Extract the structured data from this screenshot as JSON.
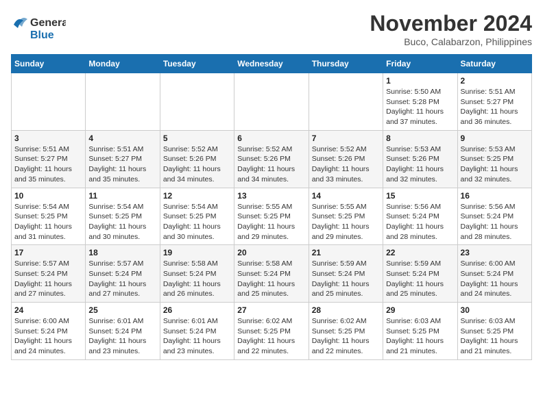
{
  "header": {
    "logo_general": "General",
    "logo_blue": "Blue",
    "month_title": "November 2024",
    "location": "Buco, Calabarzon, Philippines"
  },
  "weekdays": [
    "Sunday",
    "Monday",
    "Tuesday",
    "Wednesday",
    "Thursday",
    "Friday",
    "Saturday"
  ],
  "weeks": [
    [
      {
        "day": "",
        "info": ""
      },
      {
        "day": "",
        "info": ""
      },
      {
        "day": "",
        "info": ""
      },
      {
        "day": "",
        "info": ""
      },
      {
        "day": "",
        "info": ""
      },
      {
        "day": "1",
        "info": "Sunrise: 5:50 AM\nSunset: 5:28 PM\nDaylight: 11 hours\nand 37 minutes."
      },
      {
        "day": "2",
        "info": "Sunrise: 5:51 AM\nSunset: 5:27 PM\nDaylight: 11 hours\nand 36 minutes."
      }
    ],
    [
      {
        "day": "3",
        "info": "Sunrise: 5:51 AM\nSunset: 5:27 PM\nDaylight: 11 hours\nand 35 minutes."
      },
      {
        "day": "4",
        "info": "Sunrise: 5:51 AM\nSunset: 5:27 PM\nDaylight: 11 hours\nand 35 minutes."
      },
      {
        "day": "5",
        "info": "Sunrise: 5:52 AM\nSunset: 5:26 PM\nDaylight: 11 hours\nand 34 minutes."
      },
      {
        "day": "6",
        "info": "Sunrise: 5:52 AM\nSunset: 5:26 PM\nDaylight: 11 hours\nand 34 minutes."
      },
      {
        "day": "7",
        "info": "Sunrise: 5:52 AM\nSunset: 5:26 PM\nDaylight: 11 hours\nand 33 minutes."
      },
      {
        "day": "8",
        "info": "Sunrise: 5:53 AM\nSunset: 5:26 PM\nDaylight: 11 hours\nand 32 minutes."
      },
      {
        "day": "9",
        "info": "Sunrise: 5:53 AM\nSunset: 5:25 PM\nDaylight: 11 hours\nand 32 minutes."
      }
    ],
    [
      {
        "day": "10",
        "info": "Sunrise: 5:54 AM\nSunset: 5:25 PM\nDaylight: 11 hours\nand 31 minutes."
      },
      {
        "day": "11",
        "info": "Sunrise: 5:54 AM\nSunset: 5:25 PM\nDaylight: 11 hours\nand 30 minutes."
      },
      {
        "day": "12",
        "info": "Sunrise: 5:54 AM\nSunset: 5:25 PM\nDaylight: 11 hours\nand 30 minutes."
      },
      {
        "day": "13",
        "info": "Sunrise: 5:55 AM\nSunset: 5:25 PM\nDaylight: 11 hours\nand 29 minutes."
      },
      {
        "day": "14",
        "info": "Sunrise: 5:55 AM\nSunset: 5:25 PM\nDaylight: 11 hours\nand 29 minutes."
      },
      {
        "day": "15",
        "info": "Sunrise: 5:56 AM\nSunset: 5:24 PM\nDaylight: 11 hours\nand 28 minutes."
      },
      {
        "day": "16",
        "info": "Sunrise: 5:56 AM\nSunset: 5:24 PM\nDaylight: 11 hours\nand 28 minutes."
      }
    ],
    [
      {
        "day": "17",
        "info": "Sunrise: 5:57 AM\nSunset: 5:24 PM\nDaylight: 11 hours\nand 27 minutes."
      },
      {
        "day": "18",
        "info": "Sunrise: 5:57 AM\nSunset: 5:24 PM\nDaylight: 11 hours\nand 27 minutes."
      },
      {
        "day": "19",
        "info": "Sunrise: 5:58 AM\nSunset: 5:24 PM\nDaylight: 11 hours\nand 26 minutes."
      },
      {
        "day": "20",
        "info": "Sunrise: 5:58 AM\nSunset: 5:24 PM\nDaylight: 11 hours\nand 25 minutes."
      },
      {
        "day": "21",
        "info": "Sunrise: 5:59 AM\nSunset: 5:24 PM\nDaylight: 11 hours\nand 25 minutes."
      },
      {
        "day": "22",
        "info": "Sunrise: 5:59 AM\nSunset: 5:24 PM\nDaylight: 11 hours\nand 25 minutes."
      },
      {
        "day": "23",
        "info": "Sunrise: 6:00 AM\nSunset: 5:24 PM\nDaylight: 11 hours\nand 24 minutes."
      }
    ],
    [
      {
        "day": "24",
        "info": "Sunrise: 6:00 AM\nSunset: 5:24 PM\nDaylight: 11 hours\nand 24 minutes."
      },
      {
        "day": "25",
        "info": "Sunrise: 6:01 AM\nSunset: 5:24 PM\nDaylight: 11 hours\nand 23 minutes."
      },
      {
        "day": "26",
        "info": "Sunrise: 6:01 AM\nSunset: 5:24 PM\nDaylight: 11 hours\nand 23 minutes."
      },
      {
        "day": "27",
        "info": "Sunrise: 6:02 AM\nSunset: 5:25 PM\nDaylight: 11 hours\nand 22 minutes."
      },
      {
        "day": "28",
        "info": "Sunrise: 6:02 AM\nSunset: 5:25 PM\nDaylight: 11 hours\nand 22 minutes."
      },
      {
        "day": "29",
        "info": "Sunrise: 6:03 AM\nSunset: 5:25 PM\nDaylight: 11 hours\nand 21 minutes."
      },
      {
        "day": "30",
        "info": "Sunrise: 6:03 AM\nSunset: 5:25 PM\nDaylight: 11 hours\nand 21 minutes."
      }
    ]
  ]
}
